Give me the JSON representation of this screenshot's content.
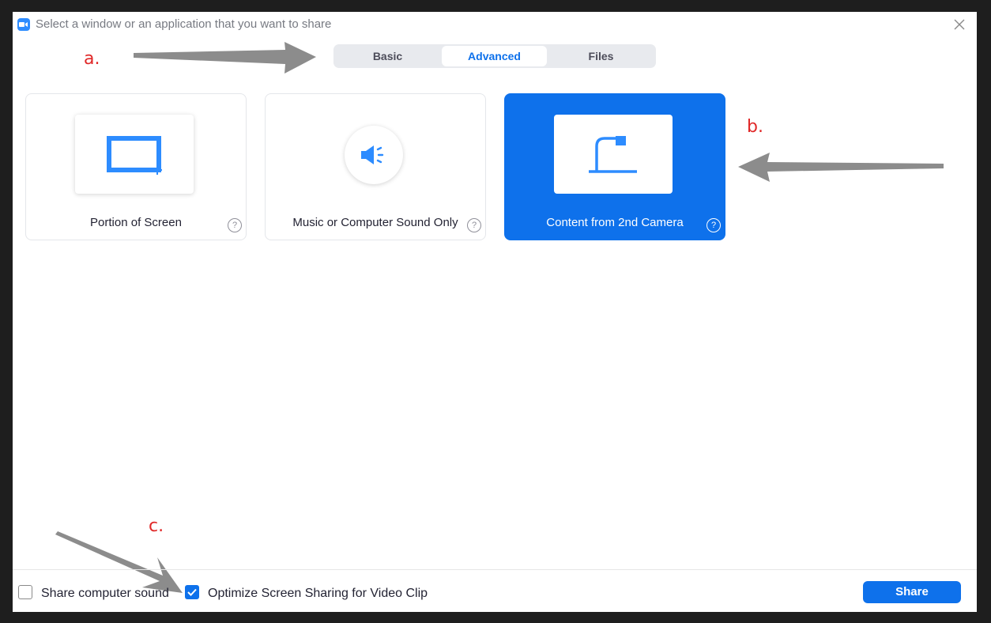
{
  "window": {
    "title": "Select a window or an application that you want to share",
    "app_icon": "zoom-camera-icon",
    "close_icon": "close-icon"
  },
  "tabs": [
    {
      "label": "Basic",
      "active": false
    },
    {
      "label": "Advanced",
      "active": true
    },
    {
      "label": "Files",
      "active": false
    }
  ],
  "cards": [
    {
      "label": "Portion of Screen",
      "icon": "portion-of-screen-icon",
      "selected": false,
      "help": "?"
    },
    {
      "label": "Music or Computer Sound Only",
      "icon": "speaker-icon",
      "selected": false,
      "help": "?"
    },
    {
      "label": "Content from 2nd Camera",
      "icon": "document-camera-icon",
      "selected": true,
      "help": "?"
    }
  ],
  "annotations": {
    "a": "a.",
    "b": "b.",
    "c": "c."
  },
  "footer": {
    "share_sound_label": "Share computer sound",
    "share_sound_checked": false,
    "optimize_label": "Optimize Screen Sharing for Video Clip",
    "optimize_checked": true,
    "share_button": "Share"
  },
  "colors": {
    "accent": "#0e71eb",
    "icon_blue": "#2d8cff",
    "annotation_red": "#e02828",
    "arrow_gray": "#8c8c8c"
  }
}
